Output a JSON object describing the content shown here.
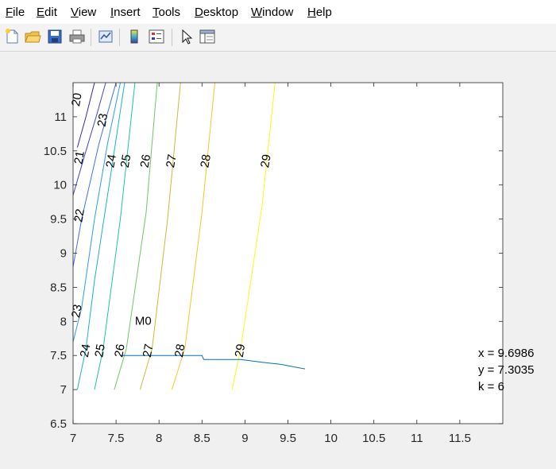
{
  "menu": {
    "items": [
      {
        "label": "File",
        "key": "F"
      },
      {
        "label": "Edit",
        "key": "E"
      },
      {
        "label": "View",
        "key": "V"
      },
      {
        "label": "Insert",
        "key": "I"
      },
      {
        "label": "Tools",
        "key": "T"
      },
      {
        "label": "Desktop",
        "key": "D"
      },
      {
        "label": "Window",
        "key": "W"
      },
      {
        "label": "Help",
        "key": "H"
      }
    ]
  },
  "toolbar": {
    "buttons": [
      "new-figure-icon",
      "open-file-icon",
      "save-icon",
      "print-icon",
      "link-plot-icon",
      "insert-colorbar-icon",
      "insert-legend-icon",
      "select-arrow-icon",
      "property-editor-icon"
    ]
  },
  "chart_data": {
    "type": "contour",
    "xlim": [
      7,
      12
    ],
    "ylim": [
      6.5,
      11.5
    ],
    "xticks": [
      "7",
      "7.5",
      "8",
      "8.5",
      "9",
      "9.5",
      "10",
      "10.5",
      "11",
      "11.5"
    ],
    "yticks": [
      "6.5",
      "7",
      "7.5",
      "8",
      "8.5",
      "9",
      "9.5",
      "10",
      "10.5",
      "11"
    ],
    "contour_levels": [
      20,
      21,
      22,
      23,
      24,
      25,
      26,
      27,
      28,
      29
    ],
    "contour_label_color": "#000000",
    "contour_lines": [
      {
        "level": 20,
        "color": "#3e26a8",
        "points": [
          [
            7.05,
            10.55
          ],
          [
            7.15,
            11.0
          ],
          [
            7.25,
            11.5
          ]
        ]
      },
      {
        "level": 21,
        "color": "#4543d6",
        "points": [
          [
            7.0,
            9.85
          ],
          [
            7.15,
            10.5
          ],
          [
            7.28,
            11.05
          ],
          [
            7.38,
            11.5
          ]
        ]
      },
      {
        "level": 22,
        "color": "#3f6ff5",
        "points": [
          [
            7.0,
            8.8
          ],
          [
            7.1,
            9.5
          ],
          [
            7.3,
            10.6
          ],
          [
            7.5,
            11.5
          ]
        ]
      },
      {
        "level": 23,
        "color": "#2b9cf0",
        "points": [
          [
            7.0,
            7.7
          ],
          [
            7.1,
            8.2
          ],
          [
            7.25,
            9.5
          ],
          [
            7.4,
            10.6
          ],
          [
            7.55,
            11.5
          ]
        ]
      },
      {
        "level": 24,
        "color": "#17b5c9",
        "points": [
          [
            7.05,
            7.0
          ],
          [
            7.15,
            7.6
          ],
          [
            7.25,
            8.6
          ],
          [
            7.42,
            10.0
          ],
          [
            7.6,
            11.5
          ]
        ]
      },
      {
        "level": 25,
        "color": "#1fc4a0",
        "points": [
          [
            7.25,
            7.0
          ],
          [
            7.35,
            7.6
          ],
          [
            7.55,
            9.5
          ],
          [
            7.72,
            11.5
          ]
        ]
      },
      {
        "level": 26,
        "color": "#6ec765",
        "points": [
          [
            7.48,
            7.0
          ],
          [
            7.62,
            7.6
          ],
          [
            7.85,
            9.6
          ],
          [
            7.98,
            11.5
          ]
        ]
      },
      {
        "level": 27,
        "color": "#c8bd3a",
        "points": [
          [
            7.78,
            7.0
          ],
          [
            7.92,
            7.6
          ],
          [
            8.1,
            9.5
          ],
          [
            8.25,
            11.5
          ]
        ]
      },
      {
        "level": 28,
        "color": "#f5c528",
        "points": [
          [
            8.15,
            7.0
          ],
          [
            8.3,
            7.6
          ],
          [
            8.5,
            9.6
          ],
          [
            8.65,
            11.5
          ]
        ]
      },
      {
        "level": 29,
        "color": "#f9fb14",
        "points": [
          [
            8.85,
            7.0
          ],
          [
            8.95,
            7.6
          ],
          [
            9.2,
            9.7
          ],
          [
            9.35,
            11.5
          ]
        ]
      }
    ],
    "contour_text_labels": [
      {
        "text": "20",
        "x": 7.05,
        "y": 11.25
      },
      {
        "text": "23",
        "x": 7.35,
        "y": 10.95
      },
      {
        "text": "21",
        "x": 7.08,
        "y": 10.4
      },
      {
        "text": "24",
        "x": 7.45,
        "y": 10.35
      },
      {
        "text": "25",
        "x": 7.62,
        "y": 10.35
      },
      {
        "text": "26",
        "x": 7.85,
        "y": 10.35
      },
      {
        "text": "27",
        "x": 8.15,
        "y": 10.35
      },
      {
        "text": "28",
        "x": 8.55,
        "y": 10.35
      },
      {
        "text": "29",
        "x": 9.25,
        "y": 10.35
      },
      {
        "text": "22",
        "x": 7.08,
        "y": 9.55
      },
      {
        "text": "23",
        "x": 7.05,
        "y": 8.15
      },
      {
        "text": "24",
        "x": 7.15,
        "y": 7.57
      },
      {
        "text": "25",
        "x": 7.32,
        "y": 7.57
      },
      {
        "text": "26",
        "x": 7.55,
        "y": 7.57
      },
      {
        "text": "27",
        "x": 7.88,
        "y": 7.57
      },
      {
        "text": "28",
        "x": 8.25,
        "y": 7.57
      },
      {
        "text": "29",
        "x": 8.95,
        "y": 7.57
      }
    ],
    "path": {
      "color": "#0072bd",
      "points": [
        [
          7.55,
          7.5
        ],
        [
          8.5,
          7.5
        ],
        [
          8.52,
          7.44
        ],
        [
          8.95,
          7.44
        ],
        [
          9.2,
          7.4
        ],
        [
          9.42,
          7.37
        ],
        [
          9.58,
          7.33
        ],
        [
          9.7,
          7.3035
        ]
      ]
    },
    "annotation": {
      "text": "M0",
      "x": 7.72,
      "y": 7.95
    },
    "readout": [
      "x = 9.6986",
      "y = 7.3035",
      "k = 6"
    ]
  }
}
